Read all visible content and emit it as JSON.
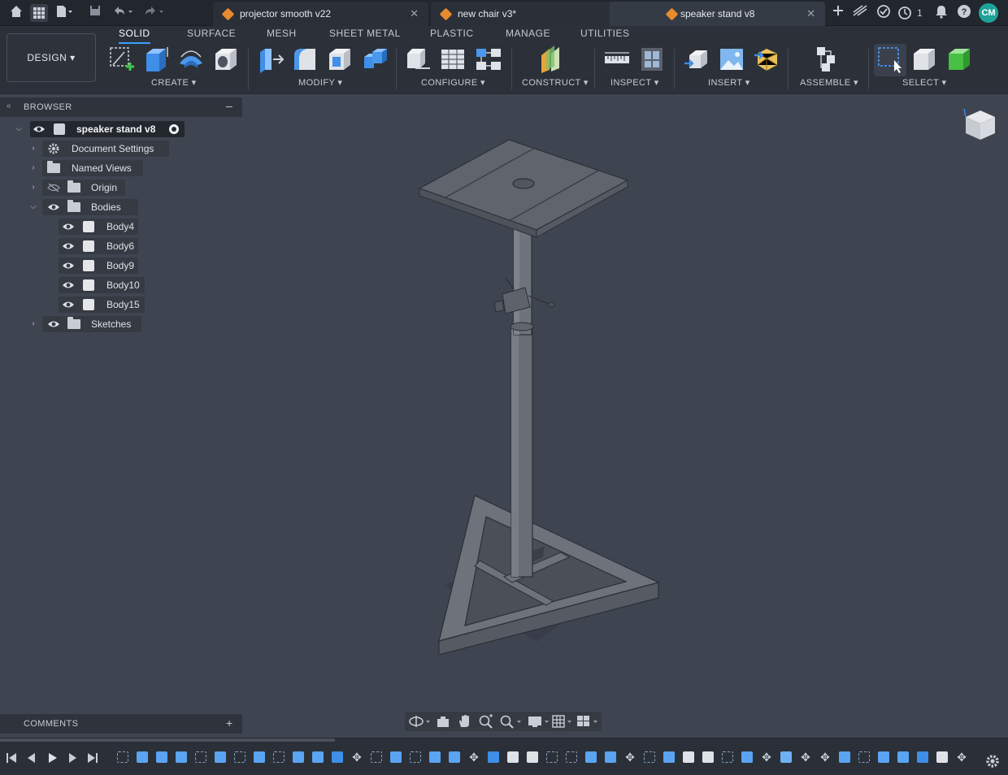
{
  "tabs": [
    {
      "label": "projector smooth v22"
    },
    {
      "label": "new chair v3*"
    },
    {
      "label": "speaker stand v8"
    }
  ],
  "top_right": {
    "job_count": "1",
    "user_initials": "CM"
  },
  "toolbar": {
    "workspace_button": "DESIGN ▾",
    "workspace_tabs": [
      "SOLID",
      "SURFACE",
      "MESH",
      "SHEET METAL",
      "PLASTIC",
      "MANAGE",
      "UTILITIES"
    ],
    "groups": [
      "CREATE ▾",
      "MODIFY ▾",
      "CONFIGURE ▾",
      "CONSTRUCT ▾",
      "INSPECT ▾",
      "INSERT ▾",
      "ASSEMBLE ▾",
      "SELECT ▾"
    ]
  },
  "browser": {
    "title": "BROWSER",
    "collapse": "–",
    "root": "speaker stand v8",
    "items": [
      {
        "label": "Document Settings"
      },
      {
        "label": "Named Views"
      },
      {
        "label": "Origin"
      },
      {
        "label": "Bodies"
      },
      {
        "label": "Body4"
      },
      {
        "label": "Body6"
      },
      {
        "label": "Body9"
      },
      {
        "label": "Body10"
      },
      {
        "label": "Body15"
      },
      {
        "label": "Sketches"
      }
    ]
  },
  "comments": {
    "title": "COMMENTS",
    "add": "+"
  },
  "colors": {
    "accent": "#3aa0ff",
    "tab_cube": "#e88a2e",
    "avatar": "#1ea39a",
    "model": "#5b6068"
  }
}
